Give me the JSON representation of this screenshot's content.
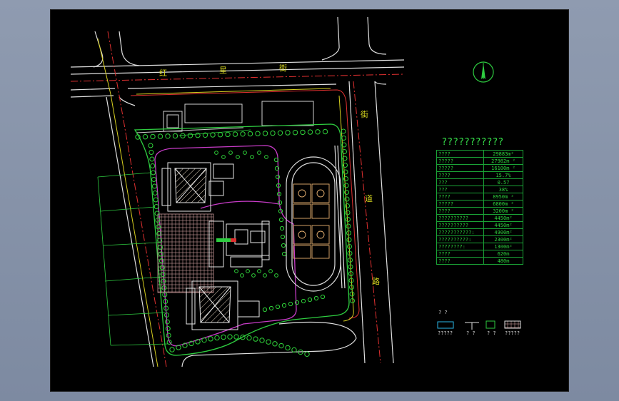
{
  "street_labels": {
    "top": [
      "红",
      "星",
      "街"
    ],
    "right": [
      "街",
      "道",
      "路"
    ]
  },
  "table": {
    "title": "???????????",
    "rows": [
      {
        "label": "????",
        "value": "29883m²"
      },
      {
        "label": "?????",
        "value": "27982m ²"
      },
      {
        "label": "?????",
        "value": "16100m ²"
      },
      {
        "label": "????",
        "value": "15.7%"
      },
      {
        "label": "???",
        "value": "0.57"
      },
      {
        "label": "???",
        "value": "38%"
      },
      {
        "label": "????",
        "value": "8950m ²"
      },
      {
        "label": "?????",
        "value": "6800m ²"
      },
      {
        "label": "????",
        "value": "3200m ²"
      },
      {
        "label": "??????????",
        "value": "4450m²"
      },
      {
        "label": "??????????",
        "value": "4450m²"
      },
      {
        "label": "???????????:",
        "value": "4900m²"
      },
      {
        "label": "??????????:",
        "value": "2300m²"
      },
      {
        "label": "????????:",
        "value": "1300m²"
      },
      {
        "label": "????",
        "value": "620m"
      },
      {
        "label": "????",
        "value": "480m"
      }
    ]
  },
  "legend": {
    "header": "? ?",
    "items": [
      "?????",
      "? ?",
      "? ?",
      "?????"
    ]
  },
  "colors": {
    "road": "#e0e0e0",
    "redline": "#e03030",
    "green": "#2ecc40",
    "magenta": "#c83cc8",
    "yellow": "#d8d020",
    "tree": "#2fd23a"
  }
}
